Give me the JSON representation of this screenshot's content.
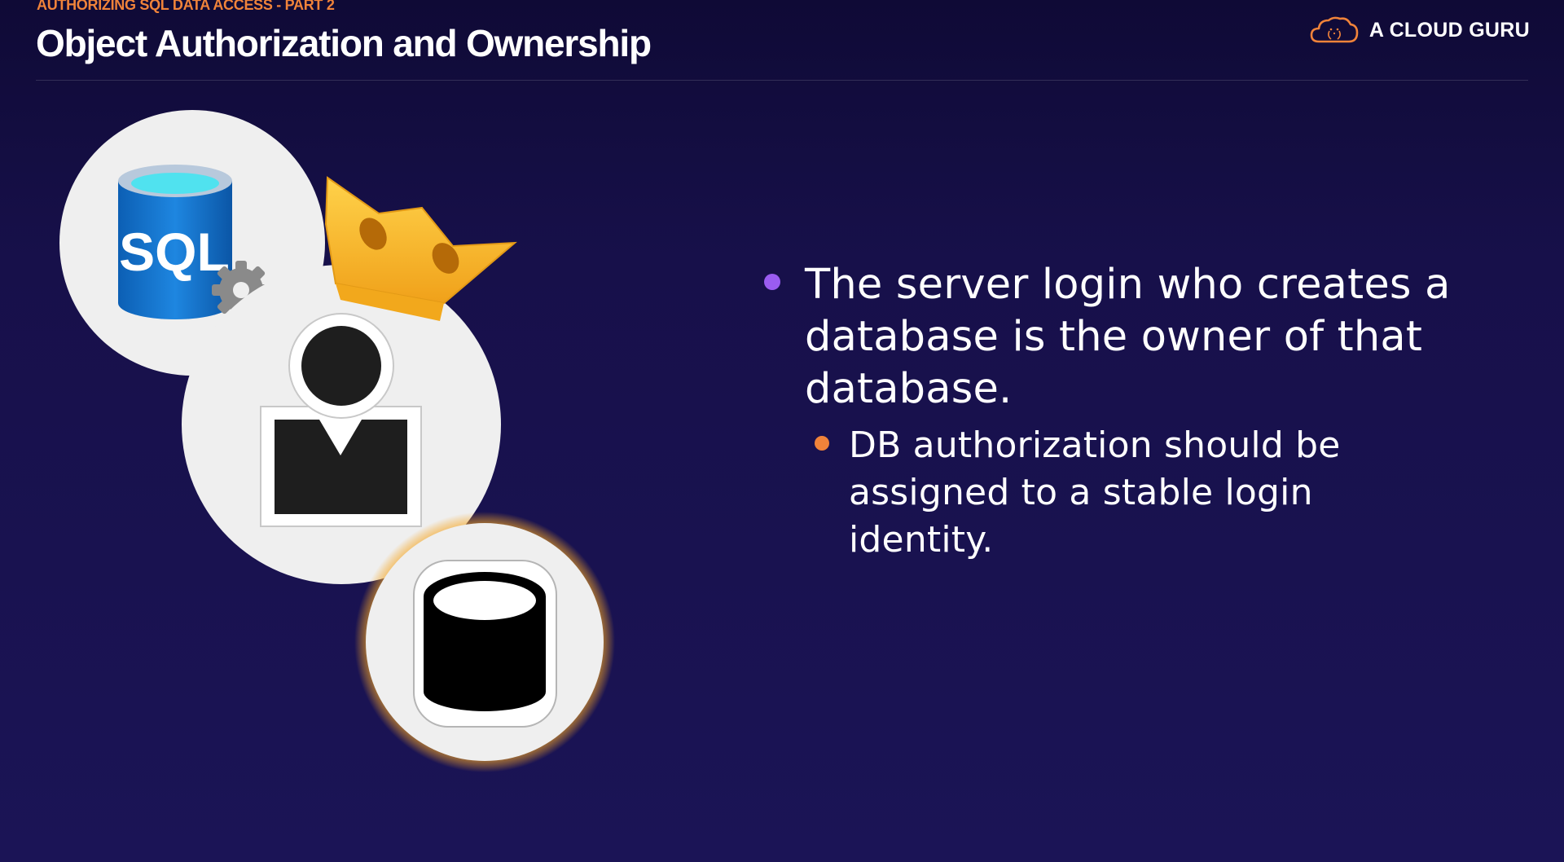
{
  "header": {
    "kicker": "AUTHORIZING SQL DATA ACCESS - PART 2",
    "title": "Object Authorization and Ownership"
  },
  "brand": {
    "name": "A CLOUD GURU",
    "logo_icon": "cloud-icon",
    "logo_color": "#f0833a"
  },
  "illustration": {
    "sql_badge_text": "SQL",
    "icons": [
      "sql-database-icon",
      "gear-icon",
      "crown-icon",
      "user-icon",
      "database-icon"
    ]
  },
  "content": {
    "bullets": [
      {
        "text": "The server login who creates a database is the owner of that database.",
        "sub_bullets": [
          {
            "text": "DB authorization should be assigned to a stable login identity."
          }
        ]
      }
    ]
  },
  "colors": {
    "background": "#17104a",
    "accent_orange": "#f0833a",
    "accent_purple": "#9a5cf0",
    "text": "#ffffff"
  }
}
